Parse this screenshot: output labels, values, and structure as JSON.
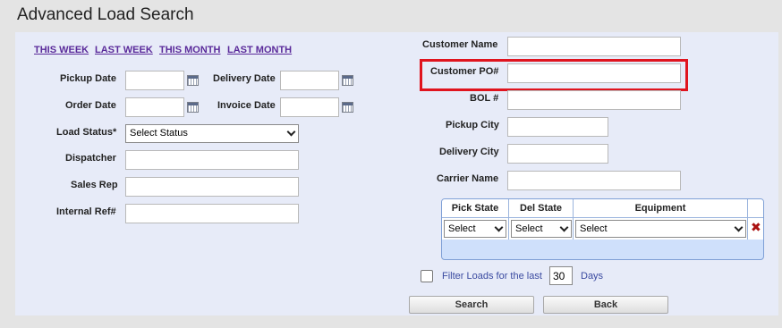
{
  "page": {
    "title": "Advanced Load Search"
  },
  "quick_links": [
    "THIS WEEK",
    "LAST WEEK",
    "THIS MONTH",
    "LAST MONTH"
  ],
  "left_form": {
    "pickup_date_label": "Pickup Date",
    "delivery_date_label": "Delivery Date",
    "order_date_label": "Order Date",
    "invoice_date_label": "Invoice Date",
    "load_status_label": "Load Status*",
    "load_status_value": "Select Status",
    "dispatcher_label": "Dispatcher",
    "sales_rep_label": "Sales Rep",
    "internal_ref_label": "Internal Ref#"
  },
  "right_form": {
    "customer_name_label": "Customer Name",
    "customer_po_label": "Customer PO#",
    "bol_label": "BOL #",
    "pickup_city_label": "Pickup City",
    "delivery_city_label": "Delivery City",
    "carrier_name_label": "Carrier Name"
  },
  "state_table": {
    "headers": [
      "Pick State",
      "Del State",
      "Equipment"
    ],
    "row": [
      "Select",
      "Select",
      "Select"
    ]
  },
  "filter": {
    "label": "Filter Loads for the last",
    "days_value": "30",
    "days_suffix": "Days"
  },
  "buttons": {
    "search": "Search",
    "back": "Back"
  },
  "colors": {
    "highlight": "#e0141e",
    "link": "#5a2a9a",
    "panel": "#e7ebf8"
  },
  "icons": {
    "calendar": "calendar-icon",
    "delete": "delete-icon",
    "chevron": "chevron-down-icon"
  }
}
